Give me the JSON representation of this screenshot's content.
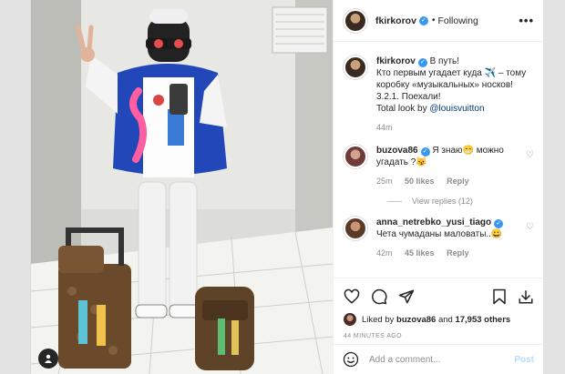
{
  "header": {
    "username": "fkirkorov",
    "separator": "•",
    "follow_status": "Following",
    "more": "•••"
  },
  "caption": {
    "username": "fkirkorov",
    "line1": "В путь!",
    "line2": "Кто первым угадает куда ✈️ – тому коробку «музыкальных» носков!",
    "line3": "3.2.1. Поехали!",
    "line4_prefix": "Total look by ",
    "line4_link": "@louisvuitton",
    "time": "44m"
  },
  "comments": [
    {
      "username": "buzova86",
      "text": "Я знаю😁 можно угадать ?😼",
      "time": "25m",
      "likes": "50 likes",
      "reply": "Reply"
    },
    {
      "username": "anna_netrebko_yusi_tiago",
      "text": "Чета чумаданы маловаты..😀",
      "time": "42m",
      "likes": "45 likes",
      "reply": "Reply"
    }
  ],
  "view_replies": "View replies (12)",
  "likes": {
    "prefix": "Liked by ",
    "user": "buzova86",
    "middle": " and ",
    "count": "17,953 others"
  },
  "timestamp": "44 MINUTES AGO",
  "add_comment": {
    "placeholder": "Add a comment...",
    "post": "Post"
  }
}
